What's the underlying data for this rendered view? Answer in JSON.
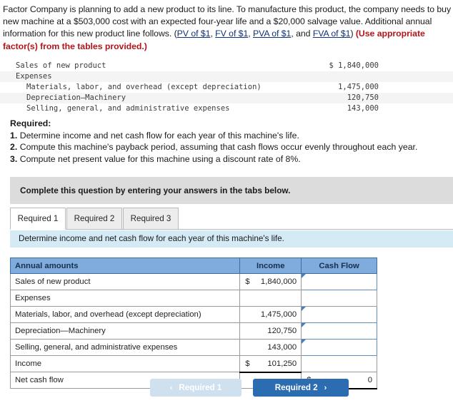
{
  "problem": {
    "part1": "Factor Company is planning to add a new product to its line. To manufacture this product, the company needs to buy a new machine at a $503,000 cost with an expected four-year life and a $20,000 salvage value. Additional annual information for this new product line follows. (",
    "links": [
      "PV of $1",
      "FV of $1",
      "PVA of $1",
      "FVA of $1"
    ],
    "sep1": ", ",
    "sep2": ", ",
    "sep3": ", and ",
    "close": ") ",
    "emphasis": "(Use appropriate factor(s) from the tables provided.)"
  },
  "mono_table": {
    "rows": [
      {
        "label": "Sales of new product",
        "value": "$ 1,840,000",
        "indent": 0,
        "shaded": false
      },
      {
        "label": "Expenses",
        "value": "",
        "indent": 0,
        "shaded": true
      },
      {
        "label": "Materials, labor, and overhead (except depreciation)",
        "value": "1,475,000",
        "indent": 1,
        "shaded": false
      },
      {
        "label": "Depreciation—Machinery",
        "value": "120,750",
        "indent": 1,
        "shaded": true
      },
      {
        "label": "Selling, general, and administrative expenses",
        "value": "143,000",
        "indent": 1,
        "shaded": false
      }
    ]
  },
  "required": {
    "heading": "Required:",
    "items": [
      {
        "num": "1.",
        "text": "Determine income and net cash flow for each year of this machine's life."
      },
      {
        "num": "2.",
        "text": "Compute this machine's payback period, assuming that cash flows occur evenly throughout each year."
      },
      {
        "num": "3.",
        "text": "Compute net present value for this machine using a discount rate of 8%."
      }
    ]
  },
  "gray_banner": "Complete this question by entering your answers in the tabs below.",
  "tabs": [
    {
      "label": "Required 1",
      "active": true
    },
    {
      "label": "Required 2",
      "active": false
    },
    {
      "label": "Required 3",
      "active": false
    }
  ],
  "blue_banner": "Determine income and net cash flow for each year of this machine's life.",
  "grid": {
    "headers": [
      "Annual amounts",
      "Income",
      "Cash Flow"
    ],
    "rows": [
      {
        "label": "Sales of new product",
        "indent": 0,
        "income_cur": "$",
        "income": "1,840,000",
        "cash_input": true,
        "cash_cur": "",
        "cash": ""
      },
      {
        "label": "Expenses",
        "indent": 0,
        "income_cur": "",
        "income": "",
        "cash_input": false,
        "cash_cur": "",
        "cash": ""
      },
      {
        "label": "Materials, labor, and overhead (except depreciation)",
        "indent": 1,
        "income_cur": "",
        "income": "1,475,000",
        "cash_input": true,
        "cash_cur": "",
        "cash": ""
      },
      {
        "label": "Depreciation—Machinery",
        "indent": 1,
        "income_cur": "",
        "income": "120,750",
        "cash_input": true,
        "cash_cur": "",
        "cash": ""
      },
      {
        "label": "Selling, general, and administrative expenses",
        "indent": 1,
        "income_cur": "",
        "income": "143,000",
        "cash_input": true,
        "cash_cur": "",
        "cash": ""
      },
      {
        "label": "Income",
        "indent": 0,
        "income_cur": "$",
        "income": "101,250",
        "cash_input": false,
        "cash_cur": "",
        "cash": ""
      },
      {
        "label": "Net cash flow",
        "indent": 0,
        "income_cur": "",
        "income": "",
        "cash_input": false,
        "cash_cur": "$",
        "cash": "0"
      }
    ]
  },
  "footer": {
    "prev_label": "Required 1",
    "prev_chevron": "‹",
    "next_label": "Required 2",
    "next_chevron": "›"
  }
}
